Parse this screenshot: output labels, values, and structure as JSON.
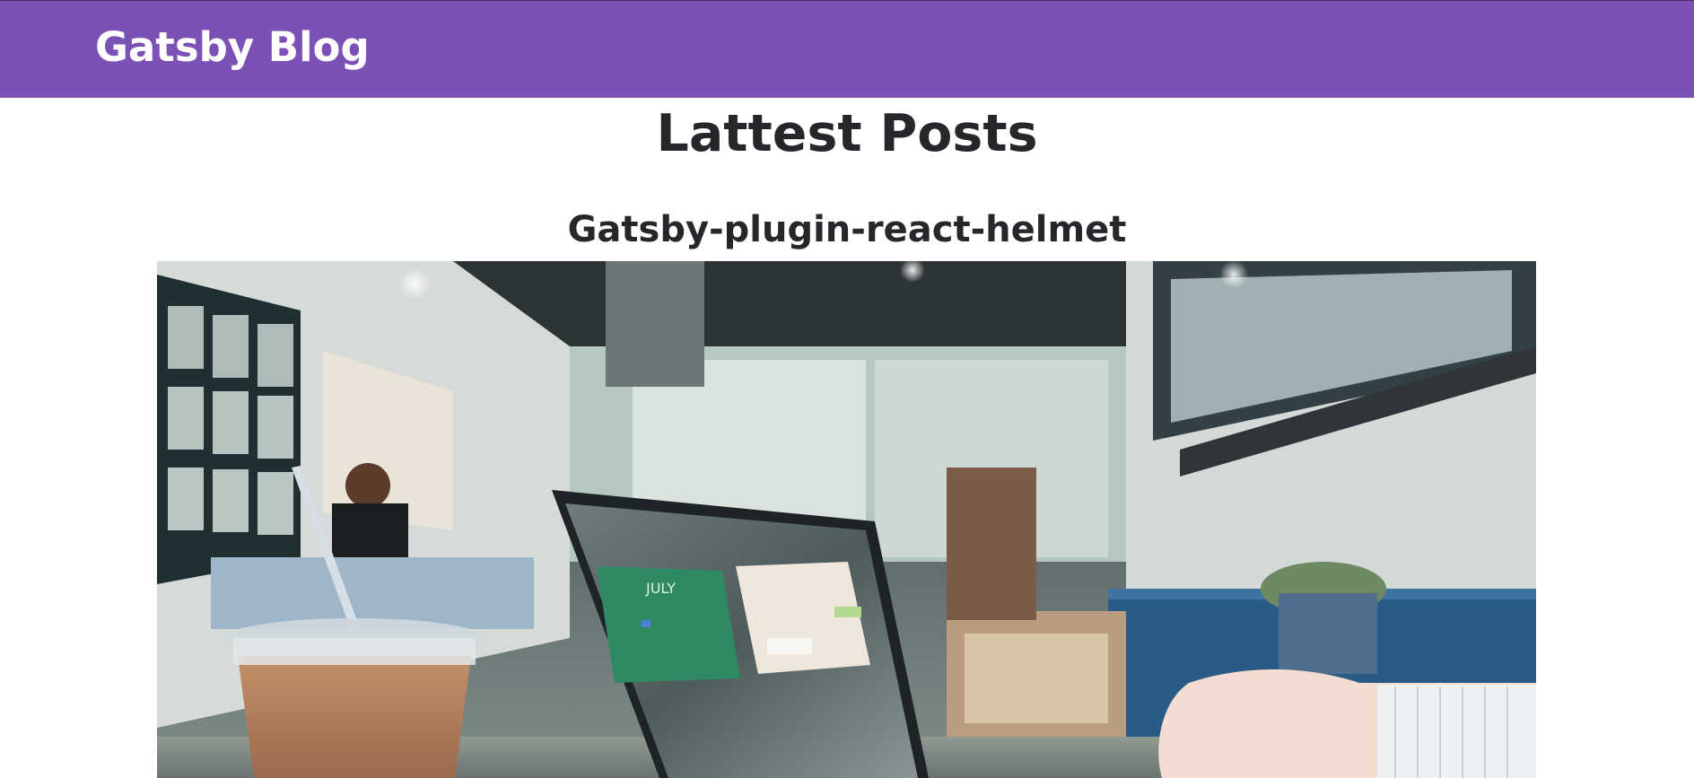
{
  "navbar": {
    "brand": "Gatsby Blog",
    "background": "#7b51b5"
  },
  "main": {
    "heading": "Lattest Posts",
    "posts": [
      {
        "title": "Gatsby-plugin-react-helmet",
        "image_alt": "Laptop on a cafe table next to an iced drink",
        "image_calendar_text": "JULY"
      }
    ]
  }
}
